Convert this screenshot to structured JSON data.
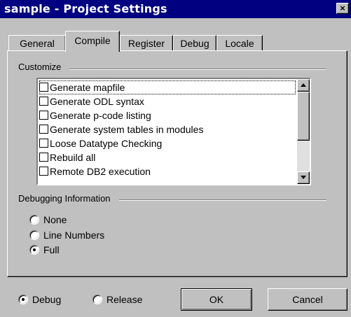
{
  "window": {
    "title": "sample - Project Settings",
    "close_glyph": "×"
  },
  "tabs": [
    {
      "label": "General",
      "active": false
    },
    {
      "label": "Compile",
      "active": true
    },
    {
      "label": "Register",
      "active": false
    },
    {
      "label": "Debug",
      "active": false
    },
    {
      "label": "Locale",
      "active": false
    }
  ],
  "customize": {
    "group_label": "Customize",
    "items": [
      {
        "label": "Generate mapfile",
        "checked": false,
        "focused": true
      },
      {
        "label": "Generate ODL syntax",
        "checked": false
      },
      {
        "label": "Generate p-code listing",
        "checked": false
      },
      {
        "label": "Generate system tables in modules",
        "checked": false
      },
      {
        "label": "Loose Datatype Checking",
        "checked": false
      },
      {
        "label": "Rebuild all",
        "checked": false
      },
      {
        "label": "Remote DB2 execution",
        "checked": false
      }
    ]
  },
  "debugging": {
    "group_label": "Debugging Information",
    "options": [
      {
        "label": "None",
        "selected": false
      },
      {
        "label": "Line Numbers",
        "selected": false
      },
      {
        "label": "Full",
        "selected": true
      }
    ]
  },
  "build_mode": {
    "options": [
      {
        "label": "Debug",
        "selected": true
      },
      {
        "label": "Release",
        "selected": false
      }
    ]
  },
  "buttons": {
    "ok_label": "OK",
    "cancel_label": "Cancel"
  },
  "colors": {
    "title_bar": "#000080",
    "face": "#c0c0c0",
    "list_background": "#ffffff"
  }
}
